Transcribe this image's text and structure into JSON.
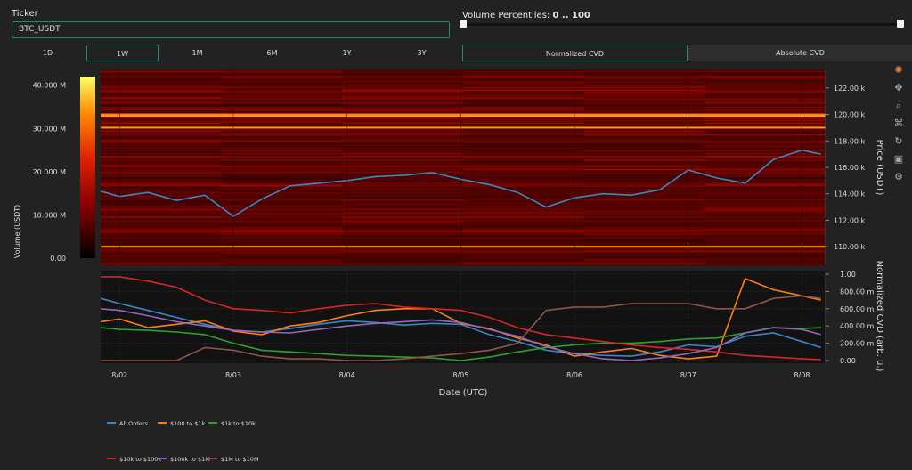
{
  "controls": {
    "ticker_label": "Ticker",
    "ticker_value": "BTC_USDT",
    "volume_percentiles_label": "Volume Percentiles: ",
    "volume_percentiles_value": "0 .. 100",
    "volume_percentile_range": [
      0,
      100
    ],
    "timeframes": [
      "1D",
      "1W",
      "1M",
      "6M",
      "1Y",
      "3Y"
    ],
    "active_timeframe": "1W",
    "cvd_modes": [
      "Normalized CVD",
      "Absolute CVD"
    ],
    "active_cvd_mode": "Normalized CVD"
  },
  "toolbar": {
    "icons": [
      "plotly-logo-icon",
      "pan-icon",
      "zoom-icon",
      "lasso-icon",
      "reset-icon",
      "save-icon",
      "settings-icon"
    ]
  },
  "colors": {
    "accent": "#1f8a70",
    "background": "#222222",
    "price_line": "#3a87c8",
    "heatmap_low": "#000000",
    "heatmap_high": "#ffff66"
  },
  "chart_data": [
    {
      "type": "heatmap",
      "colorbar": {
        "title": "Volume (USDT)",
        "ticks": [
          "40.000 M",
          "30.000 M",
          "20.000 M",
          "10.000 M",
          "0.00"
        ],
        "range": [
          0,
          42000000
        ]
      },
      "ylabel": "Price (USDT)",
      "ylim": [
        108600,
        123400
      ],
      "y_ticks": [
        "122.00 k",
        "120.00 k",
        "118.00 k",
        "116.00 k",
        "114.00 k",
        "112.00 k",
        "110.00 k"
      ],
      "y_tick_values": [
        122000,
        120000,
        118000,
        116000,
        114000,
        112000,
        110000
      ],
      "x_range_days": [
        "8/01",
        "8/08"
      ],
      "price_series": {
        "name": "",
        "x": [
          "8/01 20:00",
          "8/02 00:00",
          "8/02 06:00",
          "8/02 12:00",
          "8/02 18:00",
          "8/03 00:00",
          "8/03 06:00",
          "8/03 12:00",
          "8/03 18:00",
          "8/04 00:00",
          "8/04 06:00",
          "8/04 12:00",
          "8/04 18:00",
          "8/05 00:00",
          "8/05 06:00",
          "8/05 12:00",
          "8/05 18:00",
          "8/06 00:00",
          "8/06 06:00",
          "8/06 12:00",
          "8/06 18:00",
          "8/07 00:00",
          "8/07 06:00",
          "8/07 12:00",
          "8/07 18:00",
          "8/08 00:00",
          "8/08 04:00"
        ],
        "y": [
          114200,
          113800,
          114100,
          113500,
          113900,
          112300,
          113600,
          114600,
          114800,
          115000,
          115300,
          115400,
          115600,
          115100,
          114700,
          114100,
          113000,
          113700,
          114000,
          113900,
          114300,
          115800,
          115200,
          114800,
          116600,
          117300,
          117000
        ]
      },
      "bright_levels": [
        {
          "price": 110000,
          "intensity": 0.6
        },
        {
          "price": 119900,
          "intensity": 0.55
        },
        {
          "price": 119000,
          "intensity": 0.5
        },
        {
          "price": 120000,
          "intensity": 0.35
        }
      ]
    },
    {
      "type": "line",
      "xlabel": "Date (UTC)",
      "ylabel": "Normalized CVD (arb. u.)",
      "ylim": [
        0,
        1
      ],
      "y_ticks": [
        "1.00",
        "800.00 m",
        "600.00 m",
        "400.00 m",
        "200.00 m",
        "0.00"
      ],
      "y_tick_values": [
        1.0,
        0.8,
        0.6,
        0.4,
        0.2,
        0.0
      ],
      "x_ticks": [
        "8/02",
        "8/03",
        "8/04",
        "8/05",
        "8/06",
        "8/07",
        "8/08"
      ],
      "x": [
        "8/01 20:00",
        "8/02 00:00",
        "8/02 06:00",
        "8/02 12:00",
        "8/02 18:00",
        "8/03 00:00",
        "8/03 06:00",
        "8/03 12:00",
        "8/03 18:00",
        "8/04 00:00",
        "8/04 06:00",
        "8/04 12:00",
        "8/04 18:00",
        "8/05 00:00",
        "8/05 06:00",
        "8/05 12:00",
        "8/05 18:00",
        "8/06 00:00",
        "8/06 06:00",
        "8/06 12:00",
        "8/06 18:00",
        "8/07 00:00",
        "8/07 06:00",
        "8/07 12:00",
        "8/07 18:00",
        "8/08 00:00",
        "8/08 04:00"
      ],
      "legend_placement": "bottom",
      "series": [
        {
          "name": "All Orders",
          "color": "#3a87c8",
          "values": [
            0.72,
            0.66,
            0.58,
            0.5,
            0.42,
            0.35,
            0.33,
            0.37,
            0.42,
            0.46,
            0.44,
            0.41,
            0.43,
            0.42,
            0.3,
            0.22,
            0.12,
            0.08,
            0.06,
            0.05,
            0.1,
            0.18,
            0.16,
            0.28,
            0.32,
            0.22,
            0.15
          ]
        },
        {
          "name": "$100 to $1k",
          "color": "#ff7f0e",
          "values": [
            0.45,
            0.48,
            0.38,
            0.42,
            0.46,
            0.34,
            0.3,
            0.4,
            0.44,
            0.52,
            0.58,
            0.6,
            0.6,
            0.43,
            0.37,
            0.26,
            0.18,
            0.05,
            0.1,
            0.14,
            0.06,
            0.02,
            0.05,
            0.95,
            0.82,
            0.75,
            0.7
          ]
        },
        {
          "name": "$1k to $10k",
          "color": "#2ca02c",
          "values": [
            0.38,
            0.36,
            0.35,
            0.33,
            0.3,
            0.2,
            0.12,
            0.1,
            0.08,
            0.06,
            0.05,
            0.04,
            0.03,
            0.0,
            0.04,
            0.1,
            0.15,
            0.18,
            0.2,
            0.2,
            0.22,
            0.25,
            0.26,
            0.32,
            0.38,
            0.37,
            0.38
          ]
        },
        {
          "name": "$10k to $100k",
          "color": "#d62728",
          "values": [
            0.97,
            0.97,
            0.92,
            0.85,
            0.7,
            0.6,
            0.58,
            0.55,
            0.6,
            0.64,
            0.66,
            0.62,
            0.6,
            0.58,
            0.5,
            0.38,
            0.3,
            0.26,
            0.22,
            0.18,
            0.15,
            0.13,
            0.1,
            0.06,
            0.04,
            0.02,
            0.01
          ]
        },
        {
          "name": "$100k to $1M",
          "color": "#9467bd",
          "values": [
            0.6,
            0.58,
            0.52,
            0.45,
            0.4,
            0.35,
            0.33,
            0.32,
            0.36,
            0.4,
            0.43,
            0.45,
            0.47,
            0.44,
            0.36,
            0.28,
            0.16,
            0.08,
            0.02,
            0.0,
            0.03,
            0.08,
            0.15,
            0.32,
            0.38,
            0.36,
            0.3
          ]
        },
        {
          "name": "$1M to $10M",
          "color": "#8c564b",
          "values": [
            0.0,
            0.0,
            0.0,
            0.0,
            0.15,
            0.12,
            0.05,
            0.02,
            0.02,
            0.0,
            0.0,
            0.02,
            0.05,
            0.08,
            0.12,
            0.2,
            0.58,
            0.62,
            0.62,
            0.66,
            0.66,
            0.66,
            0.6,
            0.6,
            0.72,
            0.75,
            0.72
          ]
        }
      ]
    }
  ]
}
